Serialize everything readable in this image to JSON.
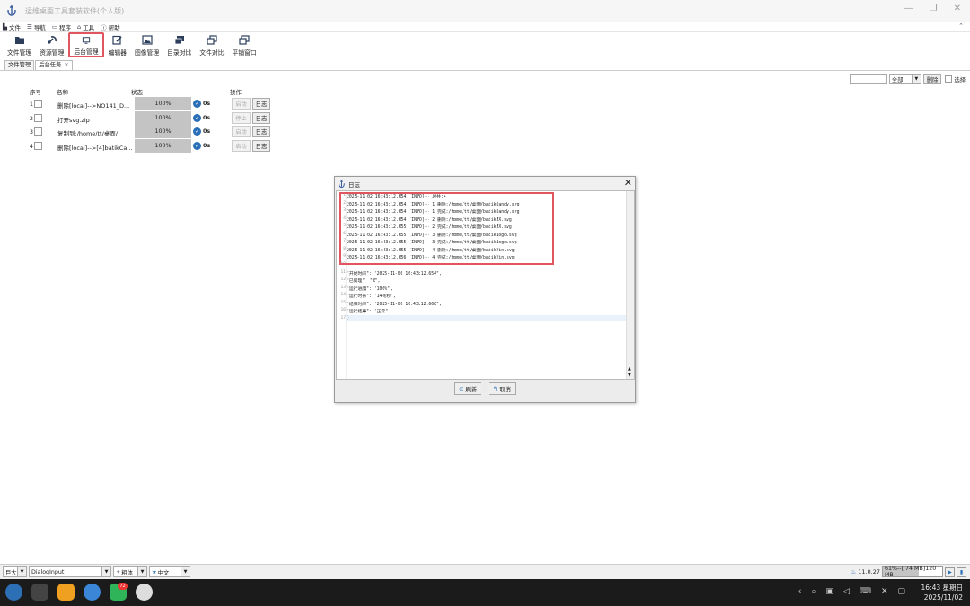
{
  "window": {
    "title": "运维桌面工具套装软件(个人版)"
  },
  "menu": [
    {
      "label": "文件",
      "icon": "file-icon"
    },
    {
      "label": "导航",
      "icon": "hamburger-icon"
    },
    {
      "label": "程序",
      "icon": "window-icon"
    },
    {
      "label": "工具",
      "icon": "toolbox-icon"
    },
    {
      "label": "帮助",
      "icon": "help-icon"
    }
  ],
  "toolbar": [
    {
      "label": "文件管理",
      "icon": "folder-icon"
    },
    {
      "label": "资源管理",
      "icon": "resource-icon"
    },
    {
      "label": "后台管理",
      "icon": "monitor-icon",
      "active": true
    },
    {
      "label": "编辑器",
      "icon": "edit-icon"
    },
    {
      "label": "图像管理",
      "icon": "image-icon"
    },
    {
      "label": "目录对比",
      "icon": "dir-compare-icon"
    },
    {
      "label": "文件对比",
      "icon": "file-compare-icon"
    },
    {
      "label": "平铺窗口",
      "icon": "tile-window-icon"
    }
  ],
  "tabs": [
    {
      "label": "文件管理"
    },
    {
      "label": "后台任务",
      "close": "×"
    }
  ],
  "filter": {
    "scope": "全部",
    "delete": "删除",
    "select": "选择"
  },
  "task_headers": {
    "index": "序号",
    "name": "名称",
    "status": "状态",
    "actions": "操作"
  },
  "tasks": [
    {
      "index": "1",
      "name": "删除[local]-->NO141_D...",
      "progress_label": "100%",
      "progress": 1.0,
      "time": "0s",
      "action": "启动",
      "log": "日志"
    },
    {
      "index": "2",
      "name": "打开svg.zip",
      "progress_label": "100%",
      "progress": 1.0,
      "time": "0s",
      "action": "停止",
      "log": "日志"
    },
    {
      "index": "3",
      "name": "复制到:/home/tt/桌面/",
      "progress_label": "100%",
      "progress": 1.0,
      "time": "0s",
      "action": "启动",
      "log": "日志"
    },
    {
      "index": "4",
      "name": "删除[local]-->[4]batikCa...",
      "progress_label": "100%",
      "progress": 1.0,
      "time": "0s",
      "action": "启动",
      "log": "日志"
    }
  ],
  "dialog": {
    "title": "日志",
    "lines": [
      {
        "n": "1",
        "text": "2025-11-02 16:43:12.654 [INFO]-- 总共:4"
      },
      {
        "n": "2",
        "text": "2025-11-02 16:43:12.654 [INFO]-- 1.删除:/home/tt/桌面/batikCandy.svg"
      },
      {
        "n": "3",
        "text": "2025-11-02 16:43:12.654 [INFO]-- 1.完成:/home/tt/桌面/batikCandy.svg"
      },
      {
        "n": "4",
        "text": "2025-11-02 16:43:12.654 [INFO]-- 2.删除:/home/tt/桌面/batikFX.svg"
      },
      {
        "n": "5",
        "text": "2025-11-02 16:43:12.655 [INFO]-- 2.完成:/home/tt/桌面/batikFX.svg"
      },
      {
        "n": "6",
        "text": "2025-11-02 16:43:12.655 [INFO]-- 3.删除:/home/tt/桌面/batikLogo.svg"
      },
      {
        "n": "7",
        "text": "2025-11-02 16:43:12.655 [INFO]-- 3.完成:/home/tt/桌面/batikLogo.svg"
      },
      {
        "n": "8",
        "text": "2025-11-02 16:43:12.655 [INFO]-- 4.删除:/home/tt/桌面/batikYin.svg"
      },
      {
        "n": "9",
        "text": "2025-11-02 16:43:12.656 [INFO]-- 4.完成:/home/tt/桌面/batikYin.svg"
      },
      {
        "n": "10",
        "text": "{"
      },
      {
        "n": "11",
        "text": "  \"开始时间\": \"2025-11-02 16:43:12.654\","
      },
      {
        "n": "12",
        "text": "  \"已处理\": \"0\","
      },
      {
        "n": "13",
        "text": "  \"运行进度\": \"100%\","
      },
      {
        "n": "14",
        "text": "  \"运行时长\": \"14毫秒\","
      },
      {
        "n": "15",
        "text": "  \"结束时间\": \"2025-11-02 16:43:12.668\","
      },
      {
        "n": "16",
        "text": "  \"运行结果\": \"正常\""
      },
      {
        "n": "17",
        "text": "}"
      }
    ],
    "refresh": "刷新",
    "cancel": "取消"
  },
  "statusbar": {
    "size": "巨大",
    "font": "DialogInput",
    "style": "粗体",
    "lang": "中文",
    "version": "11.0.27",
    "memory": "61%--[ 74 MB]120 MB",
    "memory_fraction": 0.61
  },
  "taskbar": {
    "badge": "72",
    "time": "16:43 星期日",
    "date": "2025/11/02"
  },
  "colors": {
    "highlight": "#e05560",
    "progress": "#c4c4c4",
    "ok": "#2a6fb7"
  }
}
